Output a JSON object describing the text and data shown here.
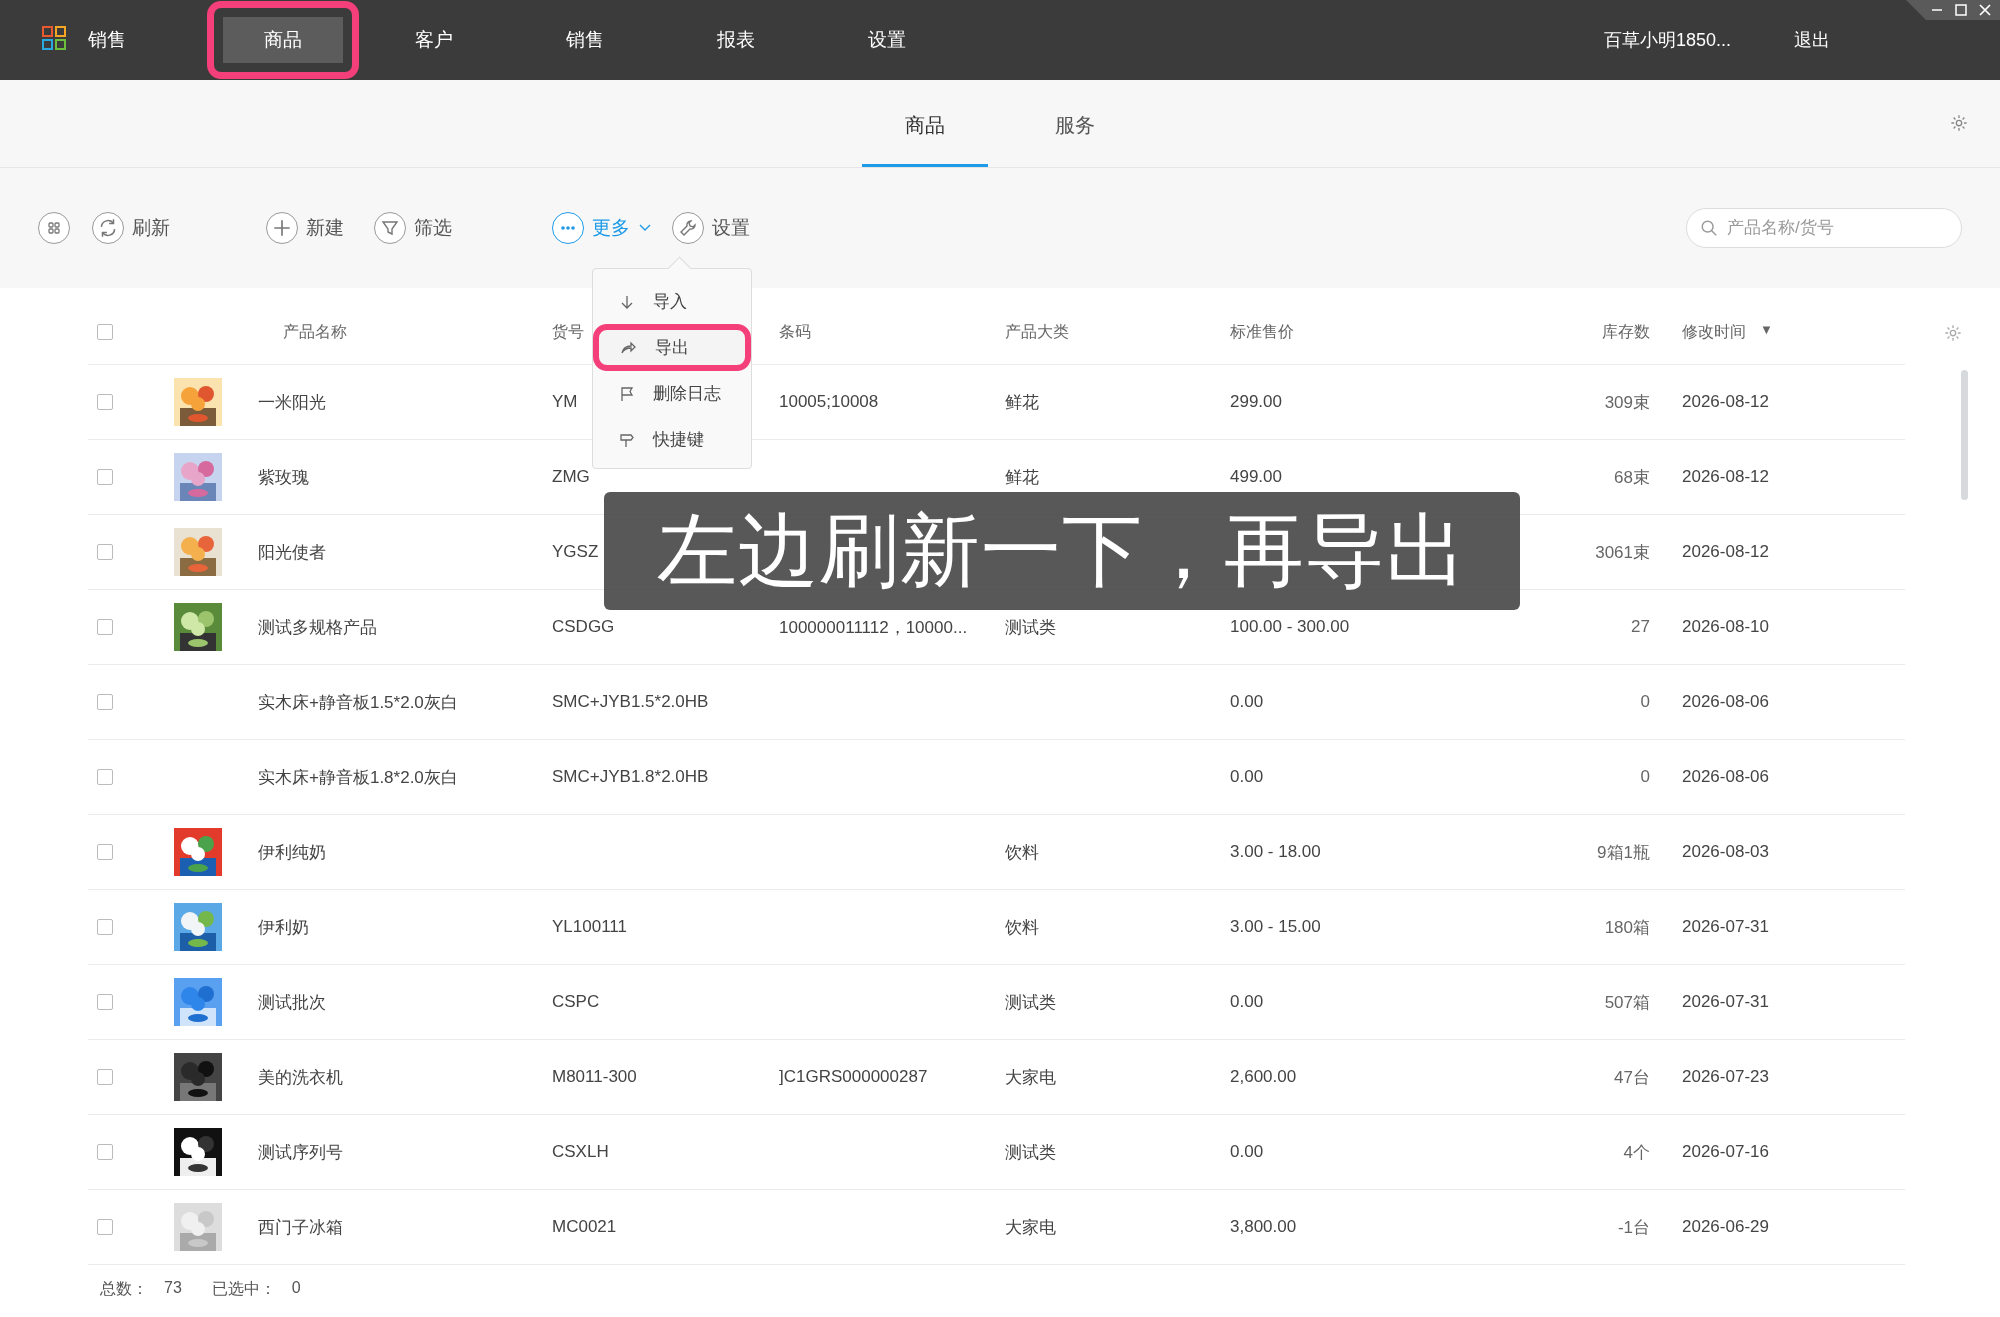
{
  "app": {
    "title": "销售"
  },
  "nav": [
    {
      "label": "商品",
      "selected": true,
      "highlighted": true
    },
    {
      "label": "客户",
      "selected": false,
      "highlighted": false
    },
    {
      "label": "销售",
      "selected": false,
      "highlighted": false
    },
    {
      "label": "报表",
      "selected": false,
      "highlighted": false
    },
    {
      "label": "设置",
      "selected": false,
      "highlighted": false
    }
  ],
  "user": {
    "name": "百草小明1850...",
    "logout": "退出"
  },
  "sub_tabs": [
    {
      "label": "商品",
      "selected": true
    },
    {
      "label": "服务",
      "selected": false
    }
  ],
  "toolbar": {
    "buttons": [
      {
        "kind": "grid"
      },
      {
        "kind": "refresh",
        "label": "刷新"
      },
      {
        "kind": "new",
        "label": "新建"
      },
      {
        "kind": "filter",
        "label": "筛选"
      },
      {
        "kind": "more",
        "label": "更多",
        "active": true
      },
      {
        "kind": "settings",
        "label": "设置"
      }
    ],
    "search": {
      "placeholder": "产品名称/货号"
    }
  },
  "more_menu": {
    "items": [
      {
        "kind": "import",
        "label": "导入",
        "highlighted": false
      },
      {
        "kind": "export",
        "label": "导出",
        "highlighted": true
      },
      {
        "kind": "log",
        "label": "删除日志",
        "highlighted": false
      },
      {
        "kind": "shortcut",
        "label": "快捷键",
        "highlighted": false
      }
    ]
  },
  "table": {
    "all_checked": false,
    "columns": [
      {
        "label": "产品名称"
      },
      {
        "label": "货号"
      },
      {
        "label": "条码"
      },
      {
        "label": "产品大类"
      },
      {
        "label": "标准售价"
      },
      {
        "label": "库存数"
      },
      {
        "label": "修改时间",
        "sort": "▼"
      }
    ],
    "rows": [
      {
        "checked": false,
        "image": true,
        "name": "一米阳光",
        "code": "YM",
        "barcode": "10005;10008",
        "category": "鲜花",
        "price": "299.00",
        "stock": "309束",
        "modified": "2026-08-12"
      },
      {
        "checked": false,
        "image": true,
        "name": "紫玫瑰",
        "code": "ZMG",
        "category": "鲜花",
        "price": "499.00",
        "stock": "68束",
        "modified": "2026-08-12"
      },
      {
        "checked": false,
        "image": true,
        "name": "阳光使者",
        "code": "YGSZ",
        "stock": "3061束",
        "modified": "2026-08-12"
      },
      {
        "checked": false,
        "image": true,
        "name": "测试多规格产品",
        "code": "CSDGG",
        "barcode": "100000011112，10000...",
        "category": "测试类",
        "price": "100.00 - 300.00",
        "stock": "27",
        "modified": "2026-08-10"
      },
      {
        "checked": false,
        "image": false,
        "name": "实木床+静音板1.5*2.0灰白",
        "code": "SMC+JYB1.5*2.0HB",
        "price": "0.00",
        "stock": "0",
        "modified": "2026-08-06"
      },
      {
        "checked": false,
        "image": false,
        "name": "实木床+静音板1.8*2.0灰白",
        "code": "SMC+JYB1.8*2.0HB",
        "price": "0.00",
        "stock": "0",
        "modified": "2026-08-06"
      },
      {
        "checked": false,
        "image": true,
        "name": "伊利纯奶",
        "category": "饮料",
        "price": "3.00 - 18.00",
        "stock": "9箱1瓶",
        "modified": "2026-08-03"
      },
      {
        "checked": false,
        "image": true,
        "name": "伊利奶",
        "code": "YL100111",
        "category": "饮料",
        "price": "3.00 - 15.00",
        "stock": "180箱",
        "modified": "2026-07-31"
      },
      {
        "checked": false,
        "image": true,
        "name": "测试批次",
        "code": "CSPC",
        "category": "测试类",
        "price": "0.00",
        "stock": "507箱",
        "modified": "2026-07-31"
      },
      {
        "checked": false,
        "image": true,
        "name": "美的洗衣机",
        "code": "M8011-300",
        "barcode": "]C1GRS000000287",
        "category": "大家电",
        "price": "2,600.00",
        "stock": "47台",
        "modified": "2026-07-23"
      },
      {
        "checked": false,
        "image": true,
        "name": "测试序列号",
        "code": "CSXLH",
        "category": "测试类",
        "price": "0.00",
        "stock": "4个",
        "modified": "2026-07-16"
      },
      {
        "checked": false,
        "image": true,
        "name": "西门子冰箱",
        "code": "MC0021",
        "category": "大家电",
        "price": "3,800.00",
        "stock": "-1台",
        "modified": "2026-06-29"
      }
    ]
  },
  "footer": [
    {
      "label": "总数：",
      "value": "73"
    },
    {
      "label": "已选中：",
      "value": "0"
    }
  ],
  "caption": {
    "text": "左边刷新一下，再导出"
  }
}
